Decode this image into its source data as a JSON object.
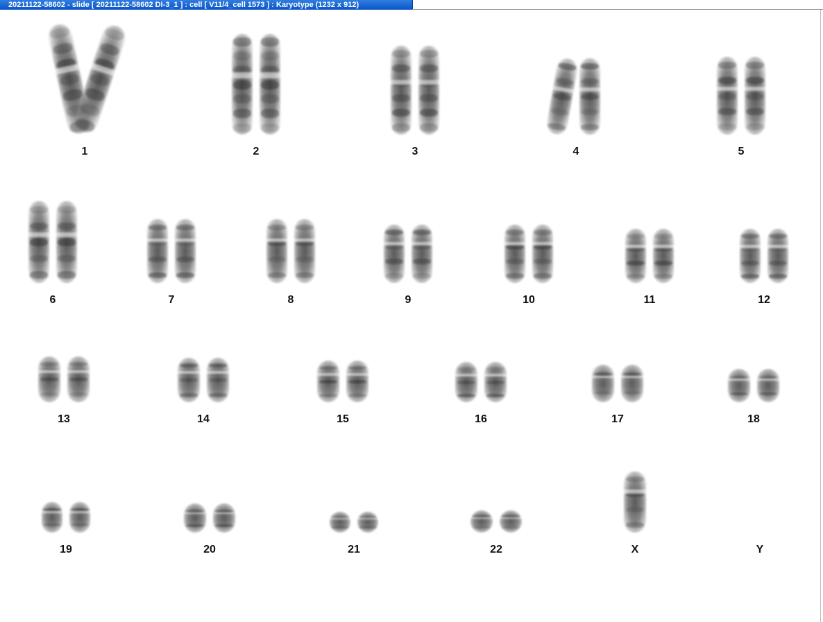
{
  "window": {
    "title": "20211122-58602 - slide [ 20211122-58602 DI-3_1 ] : cell [ V11/4_cell 1573 ] : Karyotype  (1232 x 912)"
  },
  "karyotype": {
    "chromosomes": [
      {
        "label": "1",
        "count": 2
      },
      {
        "label": "2",
        "count": 2
      },
      {
        "label": "3",
        "count": 2
      },
      {
        "label": "4",
        "count": 2
      },
      {
        "label": "5",
        "count": 2
      },
      {
        "label": "6",
        "count": 2
      },
      {
        "label": "7",
        "count": 2
      },
      {
        "label": "8",
        "count": 2
      },
      {
        "label": "9",
        "count": 2
      },
      {
        "label": "10",
        "count": 2
      },
      {
        "label": "11",
        "count": 2
      },
      {
        "label": "12",
        "count": 2
      },
      {
        "label": "13",
        "count": 2
      },
      {
        "label": "14",
        "count": 2
      },
      {
        "label": "15",
        "count": 2
      },
      {
        "label": "16",
        "count": 2
      },
      {
        "label": "17",
        "count": 2
      },
      {
        "label": "18",
        "count": 2
      },
      {
        "label": "19",
        "count": 2
      },
      {
        "label": "20",
        "count": 2
      },
      {
        "label": "21",
        "count": 2
      },
      {
        "label": "22",
        "count": 2
      },
      {
        "label": "X",
        "count": 1
      },
      {
        "label": "Y",
        "count": 0
      }
    ]
  },
  "colors": {
    "titlebar": "#0a55c8",
    "background": "#ffffff",
    "chromosome": "#555555"
  }
}
